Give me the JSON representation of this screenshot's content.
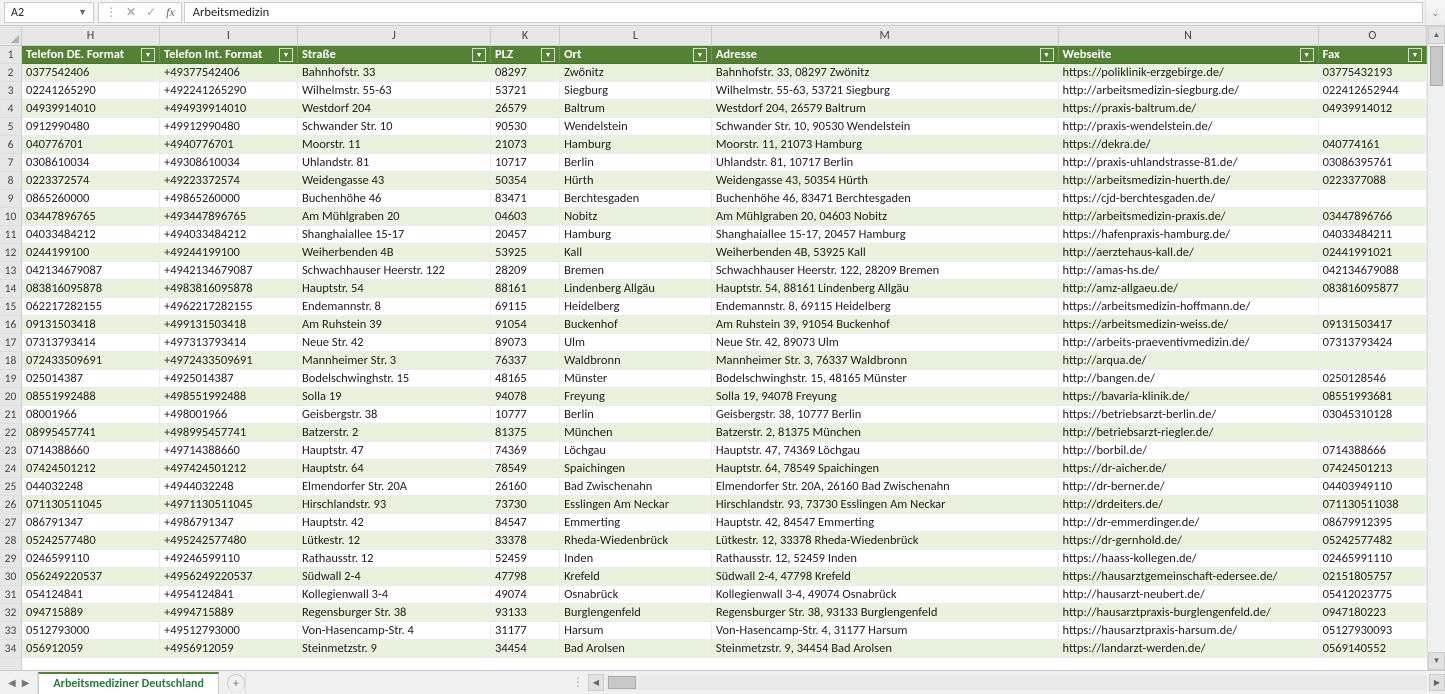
{
  "name_box": "A2",
  "formula_value": "Arbeitsmedizin",
  "sheet_tab": "Arbeitsmediziner Deutschland",
  "visible_columns": [
    "H",
    "I",
    "J",
    "K",
    "L",
    "M",
    "N",
    "O"
  ],
  "headers": {
    "H": "Telefon DE. Format",
    "I": "Telefon Int. Format",
    "J": "Straße",
    "K": "PLZ",
    "L": "Ort",
    "M": "Adresse",
    "N": "Webseite",
    "O": "Fax"
  },
  "row_numbers": [
    1,
    2,
    3,
    4,
    5,
    6,
    7,
    8,
    9,
    10,
    11,
    12,
    13,
    14,
    15,
    16,
    17,
    18,
    19,
    20,
    21,
    22,
    23,
    24,
    25,
    26,
    27,
    28,
    29,
    30,
    31,
    32,
    33,
    34
  ],
  "rows": [
    {
      "H": "0377542406",
      "I": "+49377542406",
      "J": "Bahnhofstr. 33",
      "K": "08297",
      "L": "Zwönitz",
      "M": "Bahnhofstr. 33, 08297 Zwönitz",
      "N": "https://poliklinik-erzgebirge.de/",
      "O": "03775432193"
    },
    {
      "H": "02241265290",
      "I": "+492241265290",
      "J": "Wilhelmstr. 55-63",
      "K": "53721",
      "L": "Siegburg",
      "M": "Wilhelmstr. 55-63, 53721 Siegburg",
      "N": "http://arbeitsmedizin-siegburg.de/",
      "O": "022412652944"
    },
    {
      "H": "04939914010",
      "I": "+494939914010",
      "J": "Westdorf 204",
      "K": "26579",
      "L": "Baltrum",
      "M": "Westdorf 204, 26579 Baltrum",
      "N": "https://praxis-baltrum.de/",
      "O": "04939914012"
    },
    {
      "H": "0912990480",
      "I": "+49912990480",
      "J": "Schwander Str. 10",
      "K": "90530",
      "L": "Wendelstein",
      "M": "Schwander Str. 10, 90530 Wendelstein",
      "N": "http://praxis-wendelstein.de/",
      "O": ""
    },
    {
      "H": "040776701",
      "I": "+4940776701",
      "J": "Moorstr. 11",
      "K": "21073",
      "L": "Hamburg",
      "M": "Moorstr. 11, 21073 Hamburg",
      "N": "https://dekra.de/",
      "O": "040774161"
    },
    {
      "H": "0308610034",
      "I": "+49308610034",
      "J": "Uhlandstr. 81",
      "K": "10717",
      "L": "Berlin",
      "M": "Uhlandstr. 81, 10717 Berlin",
      "N": "http://praxis-uhlandstrasse-81.de/",
      "O": "03086395761"
    },
    {
      "H": "0223372574",
      "I": "+49223372574",
      "J": "Weidengasse 43",
      "K": "50354",
      "L": "Hürth",
      "M": "Weidengasse 43, 50354 Hürth",
      "N": "http://arbeitsmedizin-huerth.de/",
      "O": "0223377088"
    },
    {
      "H": "0865260000",
      "I": "+49865260000",
      "J": "Buchenhöhe 46",
      "K": "83471",
      "L": "Berchtesgaden",
      "M": "Buchenhöhe 46, 83471 Berchtesgaden",
      "N": "https://cjd-berchtesgaden.de/",
      "O": ""
    },
    {
      "H": "03447896765",
      "I": "+493447896765",
      "J": "Am Mühlgraben 20",
      "K": "04603",
      "L": "Nobitz",
      "M": "Am Mühlgraben 20, 04603 Nobitz",
      "N": "http://arbeitsmedizin-praxis.de/",
      "O": "03447896766"
    },
    {
      "H": "04033484212",
      "I": "+494033484212",
      "J": "Shanghaiallee 15-17",
      "K": "20457",
      "L": "Hamburg",
      "M": "Shanghaiallee 15-17, 20457 Hamburg",
      "N": "https://hafenpraxis-hamburg.de/",
      "O": "04033484211"
    },
    {
      "H": "0244199100",
      "I": "+49244199100",
      "J": "Weiherbenden 4B",
      "K": "53925",
      "L": "Kall",
      "M": "Weiherbenden 4B, 53925 Kall",
      "N": "http://aerztehaus-kall.de/",
      "O": "02441991021"
    },
    {
      "H": "042134679087",
      "I": "+4942134679087",
      "J": "Schwachhauser Heerstr. 122",
      "K": "28209",
      "L": "Bremen",
      "M": "Schwachhauser Heerstr. 122, 28209 Bremen",
      "N": "http://amas-hs.de/",
      "O": "042134679088"
    },
    {
      "H": "083816095878",
      "I": "+4983816095878",
      "J": "Hauptstr. 54",
      "K": "88161",
      "L": "Lindenberg Allgäu",
      "M": "Hauptstr. 54, 88161 Lindenberg Allgäu",
      "N": "http://amz-allgaeu.de/",
      "O": "083816095877"
    },
    {
      "H": "062217282155",
      "I": "+4962217282155",
      "J": "Endemannstr. 8",
      "K": "69115",
      "L": "Heidelberg",
      "M": "Endemannstr. 8, 69115 Heidelberg",
      "N": "https://arbeitsmedizin-hoffmann.de/",
      "O": ""
    },
    {
      "H": "09131503418",
      "I": "+499131503418",
      "J": "Am Ruhstein 39",
      "K": "91054",
      "L": "Buckenhof",
      "M": "Am Ruhstein 39, 91054 Buckenhof",
      "N": "https://arbeitsmedizin-weiss.de/",
      "O": "09131503417"
    },
    {
      "H": "07313793414",
      "I": "+497313793414",
      "J": "Neue Str. 42",
      "K": "89073",
      "L": "Ulm",
      "M": "Neue Str. 42, 89073 Ulm",
      "N": "http://arbeits-praeventivmedizin.de/",
      "O": "07313793424"
    },
    {
      "H": "072433509691",
      "I": "+4972433509691",
      "J": "Mannheimer Str. 3",
      "K": "76337",
      "L": "Waldbronn",
      "M": "Mannheimer Str. 3, 76337 Waldbronn",
      "N": "http://arqua.de/",
      "O": ""
    },
    {
      "H": "025014387",
      "I": "+4925014387",
      "J": "Bodelschwinghstr. 15",
      "K": "48165",
      "L": "Münster",
      "M": "Bodelschwinghstr. 15, 48165 Münster",
      "N": "http://bangen.de/",
      "O": "0250128546"
    },
    {
      "H": "08551992488",
      "I": "+498551992488",
      "J": "Solla 19",
      "K": "94078",
      "L": "Freyung",
      "M": "Solla 19, 94078 Freyung",
      "N": "https://bavaria-klinik.de/",
      "O": "08551993681"
    },
    {
      "H": "08001966",
      "I": "+498001966",
      "J": "Geisbergstr. 38",
      "K": "10777",
      "L": "Berlin",
      "M": "Geisbergstr. 38, 10777 Berlin",
      "N": "https://betriebsarzt-berlin.de/",
      "O": "03045310128"
    },
    {
      "H": "08995457741",
      "I": "+498995457741",
      "J": "Batzerstr. 2",
      "K": "81375",
      "L": "München",
      "M": "Batzerstr. 2, 81375 München",
      "N": "http://betriebsarzt-riegler.de/",
      "O": ""
    },
    {
      "H": "0714388660",
      "I": "+49714388660",
      "J": "Hauptstr. 47",
      "K": "74369",
      "L": "Löchgau",
      "M": "Hauptstr. 47, 74369 Löchgau",
      "N": "http://borbil.de/",
      "O": "0714388666"
    },
    {
      "H": "07424501212",
      "I": "+497424501212",
      "J": "Hauptstr. 64",
      "K": "78549",
      "L": "Spaichingen",
      "M": "Hauptstr. 64, 78549 Spaichingen",
      "N": "https://dr-aicher.de/",
      "O": "07424501213"
    },
    {
      "H": "044032248",
      "I": "+4944032248",
      "J": "Elmendorfer Str. 20A",
      "K": "26160",
      "L": "Bad Zwischenahn",
      "M": "Elmendorfer Str. 20A, 26160 Bad Zwischenahn",
      "N": "http://dr-berner.de/",
      "O": "04403949110"
    },
    {
      "H": "071130511045",
      "I": "+4971130511045",
      "J": "Hirschlandstr. 93",
      "K": "73730",
      "L": "Esslingen Am Neckar",
      "M": "Hirschlandstr. 93, 73730 Esslingen Am Neckar",
      "N": "http://drdeiters.de/",
      "O": "071130511038"
    },
    {
      "H": "086791347",
      "I": "+4986791347",
      "J": "Hauptstr. 42",
      "K": "84547",
      "L": "Emmerting",
      "M": "Hauptstr. 42, 84547 Emmerting",
      "N": "http://dr-emmerdinger.de/",
      "O": "08679912395"
    },
    {
      "H": "05242577480",
      "I": "+495242577480",
      "J": "Lütkestr. 12",
      "K": "33378",
      "L": "Rheda-Wiedenbrück",
      "M": "Lütkestr. 12, 33378 Rheda-Wiedenbrück",
      "N": "https://dr-gernhold.de/",
      "O": "05242577482"
    },
    {
      "H": "0246599110",
      "I": "+49246599110",
      "J": "Rathausstr. 12",
      "K": "52459",
      "L": "Inden",
      "M": "Rathausstr. 12, 52459 Inden",
      "N": "https://haass-kollegen.de/",
      "O": "02465991110"
    },
    {
      "H": "056249220537",
      "I": "+4956249220537",
      "J": "Südwall 2-4",
      "K": "47798",
      "L": "Krefeld",
      "M": "Südwall 2-4, 47798 Krefeld",
      "N": "https://hausarztgemeinschaft-edersee.de/",
      "O": "02151805757"
    },
    {
      "H": "054124841",
      "I": "+4954124841",
      "J": "Kollegienwall 3-4",
      "K": "49074",
      "L": "Osnabrück",
      "M": "Kollegienwall 3-4, 49074 Osnabrück",
      "N": "http://hausarzt-neubert.de/",
      "O": "05412023775"
    },
    {
      "H": "094715889",
      "I": "+4994715889",
      "J": "Regensburger Str. 38",
      "K": "93133",
      "L": "Burglengenfeld",
      "M": "Regensburger Str. 38, 93133 Burglengenfeld",
      "N": "http://hausarztpraxis-burglengenfeld.de/",
      "O": "0947180223"
    },
    {
      "H": "0512793000",
      "I": "+49512793000",
      "J": "Von-Hasencamp-Str. 4",
      "K": "31177",
      "L": "Harsum",
      "M": "Von-Hasencamp-Str. 4, 31177 Harsum",
      "N": "https://hausarztpraxis-harsum.de/",
      "O": "05127930093"
    },
    {
      "H": "056912059",
      "I": "+4956912059",
      "J": "Steinmetzstr. 9",
      "K": "34454",
      "L": "Bad Arolsen",
      "M": "Steinmetzstr. 9, 34454 Bad Arolsen",
      "N": "https://landarzt-werden.de/",
      "O": "0569140552"
    }
  ]
}
